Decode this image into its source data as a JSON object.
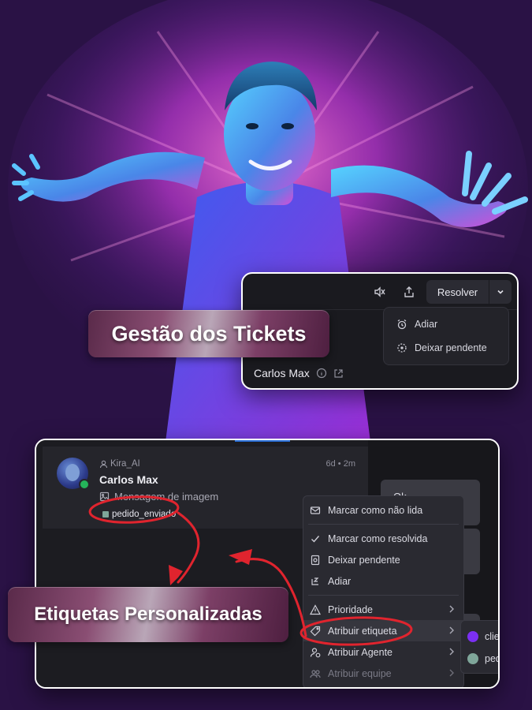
{
  "labels": {
    "tickets": "Gestão dos Tickets",
    "tags": "Etiquetas Personalizadas"
  },
  "top_panel": {
    "resolve_label": "Resolver",
    "dropdown": [
      {
        "label": "Adiar",
        "icon": "alarm-icon"
      },
      {
        "label": "Deixar pendente",
        "icon": "pending-circle-icon"
      }
    ],
    "contact_name": "Carlos Max"
  },
  "conversation": {
    "agent": "Kira_AI",
    "time": "6d • 2m",
    "name": "Carlos Max",
    "message": "Mensagem de imagem",
    "tag": "pedido_enviado"
  },
  "chat": {
    "bubble": "Ok"
  },
  "context_menu": {
    "items": [
      {
        "label": "Marcar como não lida",
        "icon": "mail-icon"
      },
      {
        "label": "Marcar como resolvida",
        "icon": "check-icon"
      },
      {
        "label": "Deixar pendente",
        "icon": "pending-icon"
      },
      {
        "label": "Adiar",
        "icon": "snooze-icon"
      },
      {
        "label": "Prioridade",
        "icon": "warning-icon"
      },
      {
        "label": "Atribuir etiqueta",
        "icon": "tag-icon"
      },
      {
        "label": "Atribuir Agente",
        "icon": "user-assign-icon"
      },
      {
        "label": "Atribuir equipe",
        "icon": "team-icon"
      }
    ],
    "submenu": [
      {
        "label": "clie",
        "color": "#7b2ff2"
      },
      {
        "label": "ped",
        "color": "#7fa69a"
      }
    ]
  },
  "colors": {
    "background": "#2a1245",
    "panel": "#1a1a1f",
    "annotation": "#e0242e"
  }
}
